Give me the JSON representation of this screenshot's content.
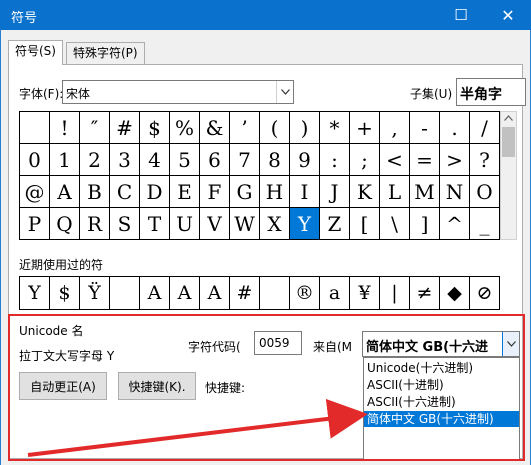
{
  "window": {
    "title": "符号",
    "maximize_glyph": "☐",
    "close_glyph": "✕"
  },
  "tabs": [
    {
      "label": "符号(S)",
      "active": true
    },
    {
      "label": "特殊字符(P)",
      "active": false
    }
  ],
  "font": {
    "label": "字体(F):",
    "value": "宋体"
  },
  "subset": {
    "label": "子集(U)",
    "value": "半角字"
  },
  "symbols": [
    [
      " ",
      "!",
      "″",
      "#",
      "$",
      "%",
      "&",
      "’",
      "(",
      ")",
      "*",
      "+",
      ",",
      "-",
      ".",
      "/"
    ],
    [
      "0",
      "1",
      "2",
      "3",
      "4",
      "5",
      "6",
      "7",
      "8",
      "9",
      ":",
      ";",
      "<",
      "=",
      ">",
      "?"
    ],
    [
      "@",
      "A",
      "B",
      "C",
      "D",
      "E",
      "F",
      "G",
      "H",
      "I",
      "J",
      "K",
      "L",
      "M",
      "N",
      "O"
    ],
    [
      "P",
      "Q",
      "R",
      "S",
      "T",
      "U",
      "V",
      "W",
      "X",
      "Y",
      "Z",
      "[",
      "\\",
      "]",
      "^",
      "_"
    ]
  ],
  "selected_symbol": "Y",
  "recent": {
    "label": "近期使用过的符",
    "items": [
      "Y",
      "$",
      "Ÿ",
      "",
      "A",
      "A",
      "A",
      "#",
      "",
      "®",
      "a",
      "¥",
      "|",
      "≠",
      "◆",
      "⊘"
    ]
  },
  "unicode": {
    "name_label": "Unicode 名",
    "char_name": "拉丁文大写字母 Y"
  },
  "char_code": {
    "label": "字符代码(",
    "value": "0059"
  },
  "from": {
    "label": "来自(M",
    "value": "简体中文 GB(十六进"
  },
  "encoding_options": [
    "Unicode(十六进制)",
    "ASCII(十进制)",
    "ASCII(十六进制)",
    "简体中文 GB(十六进制)"
  ],
  "buttons": {
    "autocorrect": "自动更正(A)",
    "shortcut_key": "快捷键(K)."
  },
  "shortcut_label": "快捷键:",
  "colors": {
    "titlebar": "#0a72cc",
    "selection": "#0078d7",
    "annotation": "#e32a2a"
  }
}
